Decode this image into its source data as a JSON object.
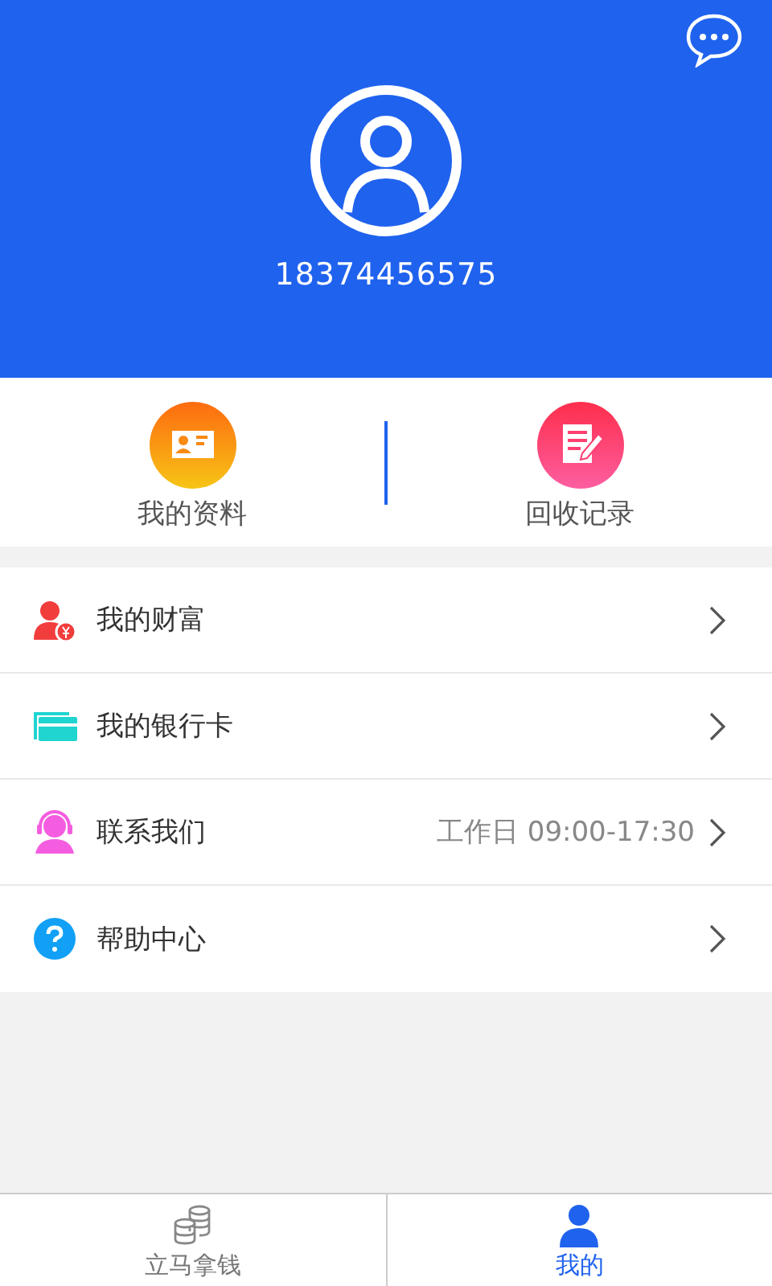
{
  "profile": {
    "phone": "18374456575"
  },
  "shortcuts": [
    {
      "kind": "profile",
      "label": "我的资料"
    },
    {
      "kind": "records",
      "label": "回收记录"
    }
  ],
  "menu": [
    {
      "kind": "wealth",
      "label": "我的财富"
    },
    {
      "kind": "card",
      "label": "我的银行卡"
    },
    {
      "kind": "contact",
      "label": "联系我们",
      "note": "工作日 09:00-17:30"
    },
    {
      "kind": "help",
      "label": "帮助中心"
    }
  ],
  "tabs": [
    {
      "kind": "coins",
      "label": "立马拿钱",
      "selected": false
    },
    {
      "kind": "person",
      "label": "我的",
      "selected": true
    }
  ]
}
